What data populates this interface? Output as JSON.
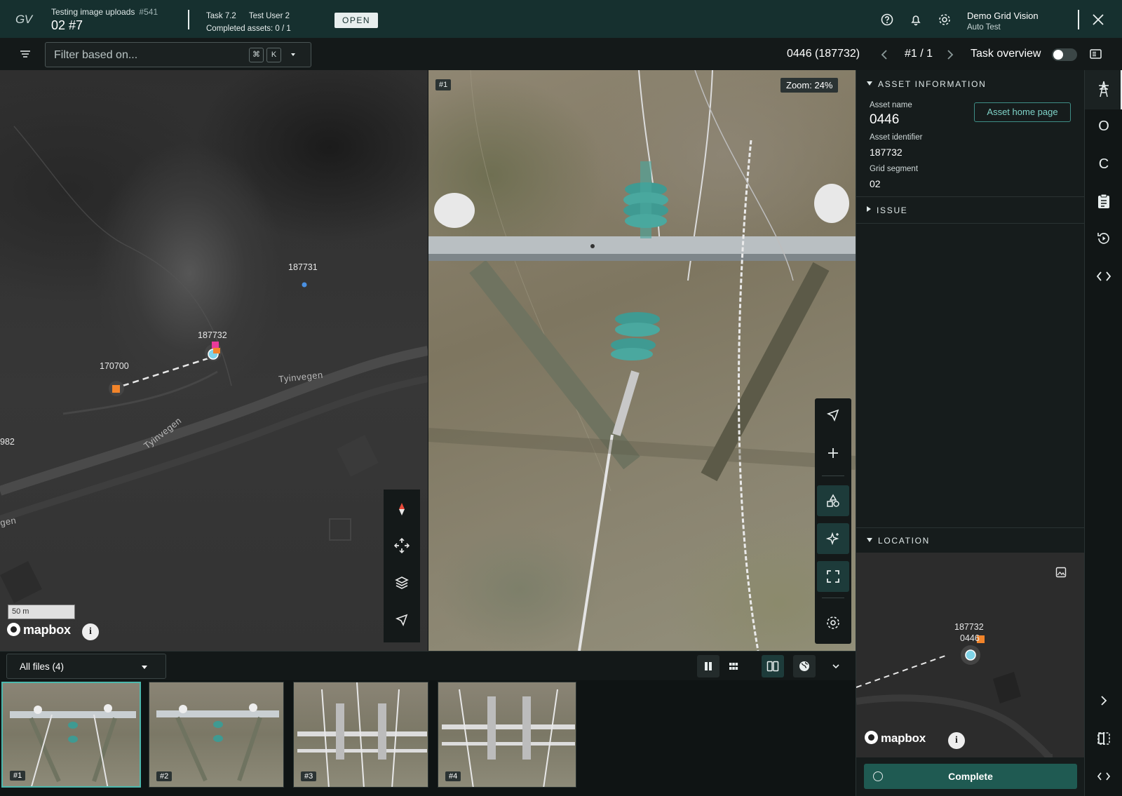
{
  "header": {
    "logo": "GV",
    "project_name": "Testing image uploads",
    "project_number": "#541",
    "segment_label": "02 #7",
    "task_name": "Task 7.2",
    "task_user": "Test User 2",
    "completed_assets": "Completed assets: 0 / 1",
    "status": "OPEN",
    "user_name": "Demo Grid Vision",
    "user_org": "Auto Test",
    "icons": [
      "help-icon",
      "bell-icon",
      "gear-icon",
      "close-icon"
    ]
  },
  "toolbar": {
    "filter_placeholder": "Filter based on...",
    "shortcut_cmd": "⌘",
    "shortcut_key": "K",
    "asset_title": "0446 (187732)",
    "pager": "#1 / 1",
    "task_overview_label": "Task overview",
    "task_overview_on": false
  },
  "map": {
    "labels": {
      "p187731": "187731",
      "p187732": "187732",
      "p170700": "170700",
      "p982": "982",
      "gen": "gen"
    },
    "roads": [
      "Tyinvegen",
      "Tyinvegen"
    ],
    "scale": "50 m",
    "brand": "mapbox"
  },
  "viewer": {
    "image_index": "#1",
    "zoom": "Zoom: 24%"
  },
  "asset_info": {
    "section_title": "ASSET INFORMATION",
    "name_label": "Asset name",
    "name_value": "0446",
    "home_button": "Asset home page",
    "identifier_label": "Asset identifier",
    "identifier_value": "187732",
    "segment_label": "Grid segment",
    "segment_value": "02"
  },
  "issue": {
    "section_title": "ISSUE"
  },
  "location": {
    "section_title": "LOCATION",
    "pole_id": "187732",
    "asset_name": "0446",
    "brand": "mapbox"
  },
  "complete_button": "Complete",
  "files": {
    "filter_value": "All files (4)",
    "thumbnails": [
      "#1",
      "#2",
      "#3",
      "#4"
    ],
    "selected": "#1"
  },
  "rail": {
    "icons": [
      "pylon-icon",
      "letter-o-icon",
      "letter-c-icon",
      "clipboard-icon",
      "history-icon",
      "code-icon"
    ],
    "o_label": "O",
    "c_label": "C"
  },
  "colors": {
    "accent": "#1f5a52",
    "header_bg": "#16302f",
    "marker_orange": "#f2842a",
    "marker_pink": "#e83a9a",
    "marker_blue": "#4a90e2"
  }
}
